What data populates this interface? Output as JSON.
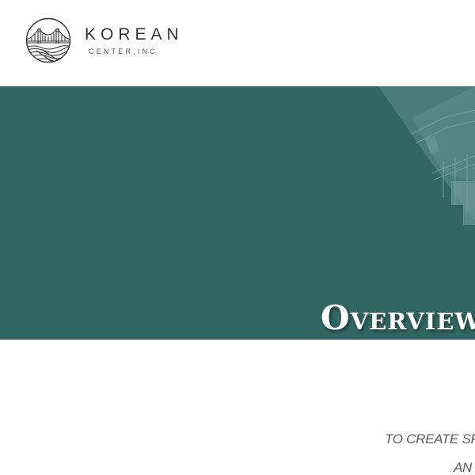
{
  "header": {
    "logo": {
      "icon": "bridge-wave-emblem-icon",
      "name": "KOREAN",
      "subtitle": "CENTER,INC"
    }
  },
  "hero": {
    "title": "Overview",
    "background_color": "#326664",
    "photo_overlay_color": "#5a8886"
  },
  "mission": {
    "line1": "TO CREATE SPA",
    "line2": "AN"
  }
}
